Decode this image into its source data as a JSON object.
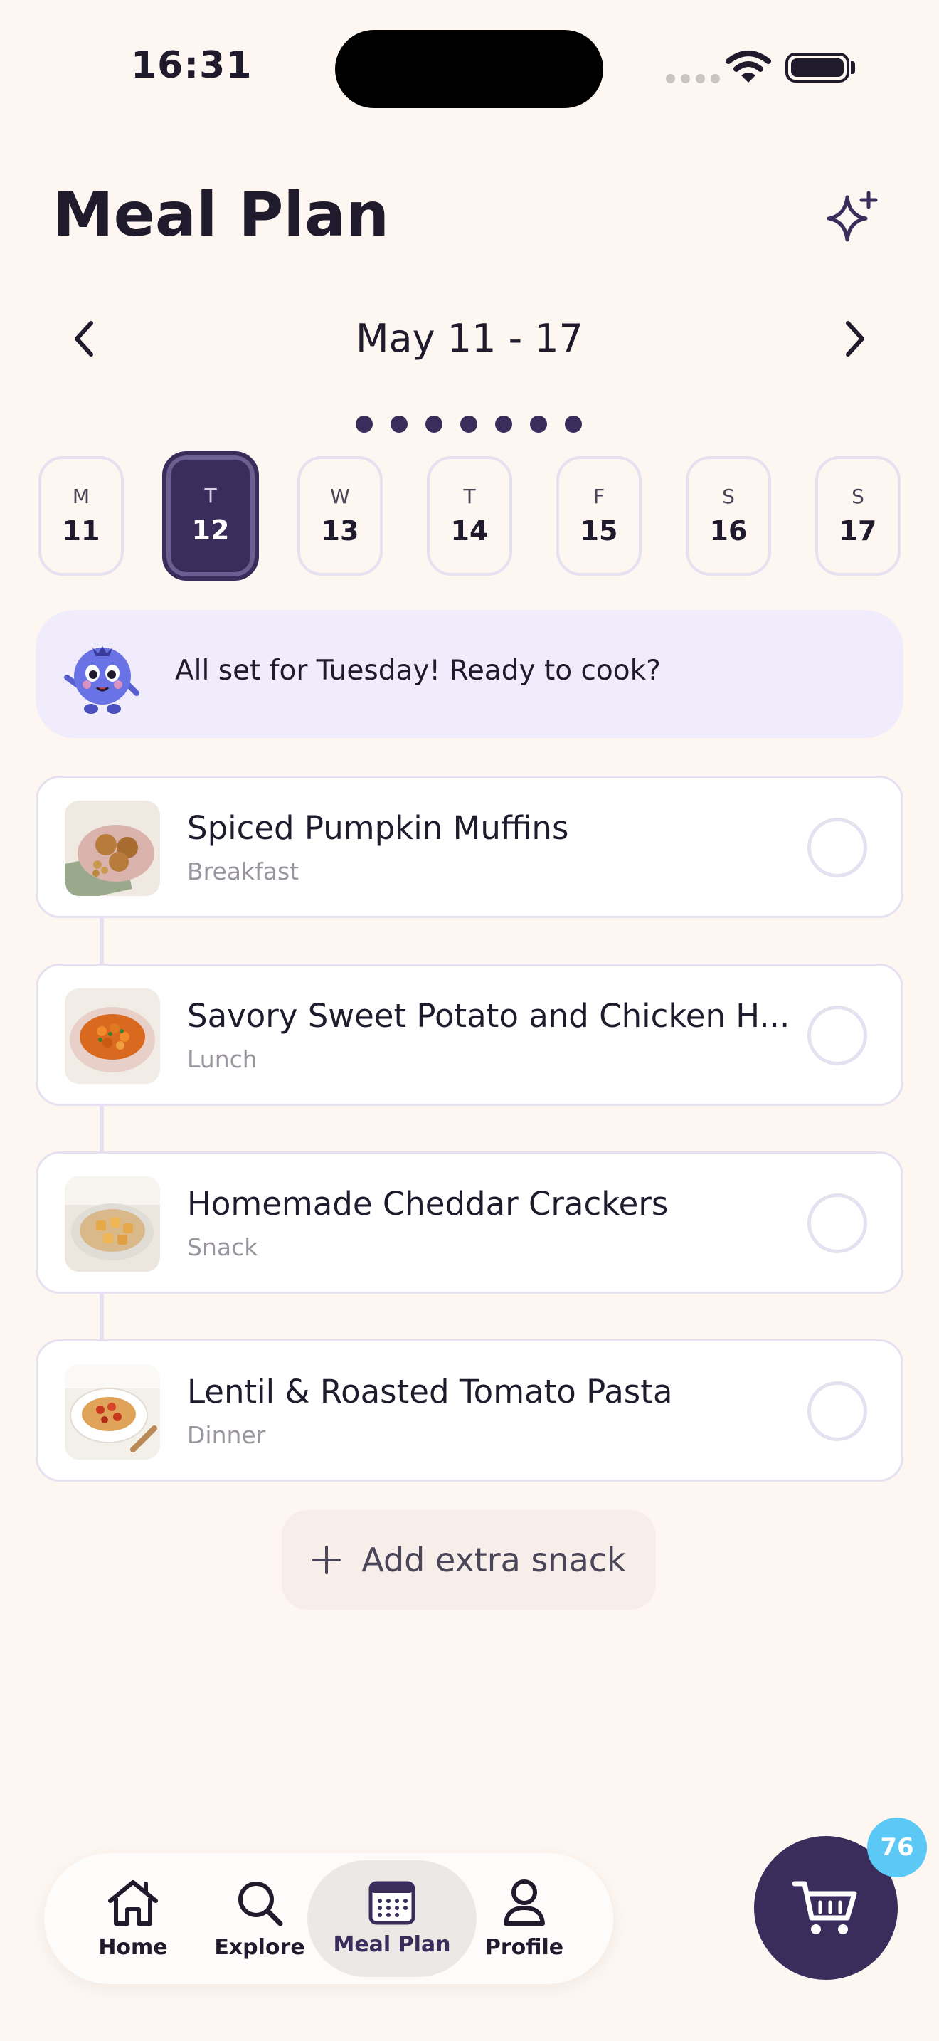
{
  "status_bar": {
    "time": "16:31"
  },
  "header": {
    "title": "Meal Plan"
  },
  "week": {
    "label": "May 11 - 17"
  },
  "days": [
    {
      "letter": "M",
      "number": "11"
    },
    {
      "letter": "T",
      "number": "12"
    },
    {
      "letter": "W",
      "number": "13"
    },
    {
      "letter": "T",
      "number": "14"
    },
    {
      "letter": "F",
      "number": "15"
    },
    {
      "letter": "S",
      "number": "16"
    },
    {
      "letter": "S",
      "number": "17"
    }
  ],
  "banner": {
    "text": "All set for Tuesday! Ready to cook?"
  },
  "meals": [
    {
      "name": "Spiced Pumpkin Muffins",
      "type": "Breakfast"
    },
    {
      "name": "Savory Sweet Potato and Chicken H...",
      "type": "Lunch"
    },
    {
      "name": "Homemade Cheddar Crackers",
      "type": "Snack"
    },
    {
      "name": "Lentil & Roasted Tomato Pasta",
      "type": "Dinner"
    }
  ],
  "add_snack": {
    "label": "Add extra snack"
  },
  "tabs": [
    {
      "label": "Home",
      "icon": "home-icon"
    },
    {
      "label": "Explore",
      "icon": "search-icon"
    },
    {
      "label": "Meal Plan",
      "icon": "calendar-icon"
    },
    {
      "label": "Profile",
      "icon": "person-icon"
    }
  ],
  "cart": {
    "count": "76"
  },
  "colors": {
    "accent": "#3a2d5c",
    "background": "#fdf6f1",
    "badge": "#5bc8f5",
    "banner": "#f1ecfc"
  }
}
